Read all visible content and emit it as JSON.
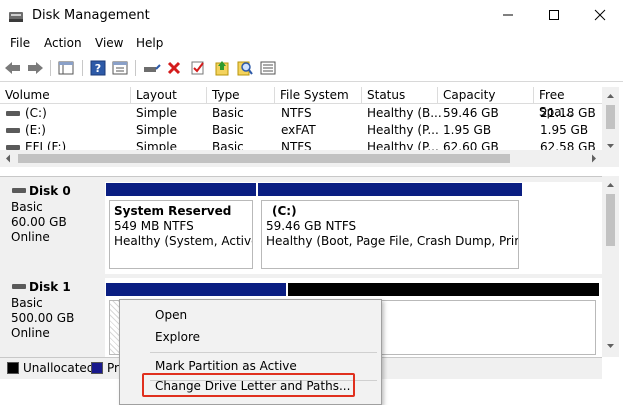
{
  "window": {
    "title": "Disk Management",
    "app_icon": "disk-management-icon",
    "controls": [
      "minimize-icon",
      "maximize-icon",
      "close-icon"
    ]
  },
  "menu": [
    "File",
    "Action",
    "View",
    "Help"
  ],
  "toolbar": {
    "icons": [
      "back-arrow-icon",
      "forward-arrow-icon",
      "console-tree-icon",
      "help-icon",
      "properties-icon",
      "connect-disk-icon",
      "delete-icon",
      "check-icon",
      "import-icon",
      "search-icon",
      "list-view-icon"
    ]
  },
  "volume_list": {
    "columns": [
      "Volume",
      "Layout",
      "Type",
      "File System",
      "Status",
      "Capacity",
      "Free Spa..."
    ],
    "rows": [
      [
        "(C:)",
        "Simple",
        "Basic",
        "NTFS",
        "Healthy (B...",
        "59.46 GB",
        "21.18 GB"
      ],
      [
        "(E:)",
        "Simple",
        "Basic",
        "exFAT",
        "Healthy (P...",
        "1.95 GB",
        "1.95 GB"
      ],
      [
        "EFI (F:)",
        "Simple",
        "Basic",
        "NTFS",
        "Healthy (P...",
        "62.60 GB",
        "62.58 GB"
      ]
    ]
  },
  "disks": [
    {
      "name": "Disk 0",
      "type": "Basic",
      "size": "60.00 GB",
      "status": "Online",
      "partitions": [
        {
          "name": "System Reserved",
          "size": "549 MB NTFS",
          "status": "Healthy (System, Active, P"
        },
        {
          "name": "(C:)",
          "size": "59.46 GB NTFS",
          "status": "Healthy (Boot, Page File, Crash Dump, Primary"
        }
      ]
    },
    {
      "name": "Disk 1",
      "type": "Basic",
      "size": "500.00 GB",
      "status": "Online",
      "partitions": [
        {
          "name": "",
          "size": "",
          "status": ""
        },
        {
          "name": "",
          "size": "",
          "status": ""
        }
      ]
    }
  ],
  "legend": [
    {
      "label": "Unallocated",
      "color": "#000000"
    },
    {
      "label": "Pri",
      "color": "#1a1a8c"
    }
  ],
  "context_menu": {
    "items": [
      "Open",
      "Explore",
      "Mark Partition as Active",
      "Change Drive Letter and Paths..."
    ],
    "highlighted": "Change Drive Letter and Paths..."
  },
  "colors": {
    "primary_partition": "#0a1e82",
    "unallocated": "#000000",
    "highlight": "#e0301e"
  }
}
